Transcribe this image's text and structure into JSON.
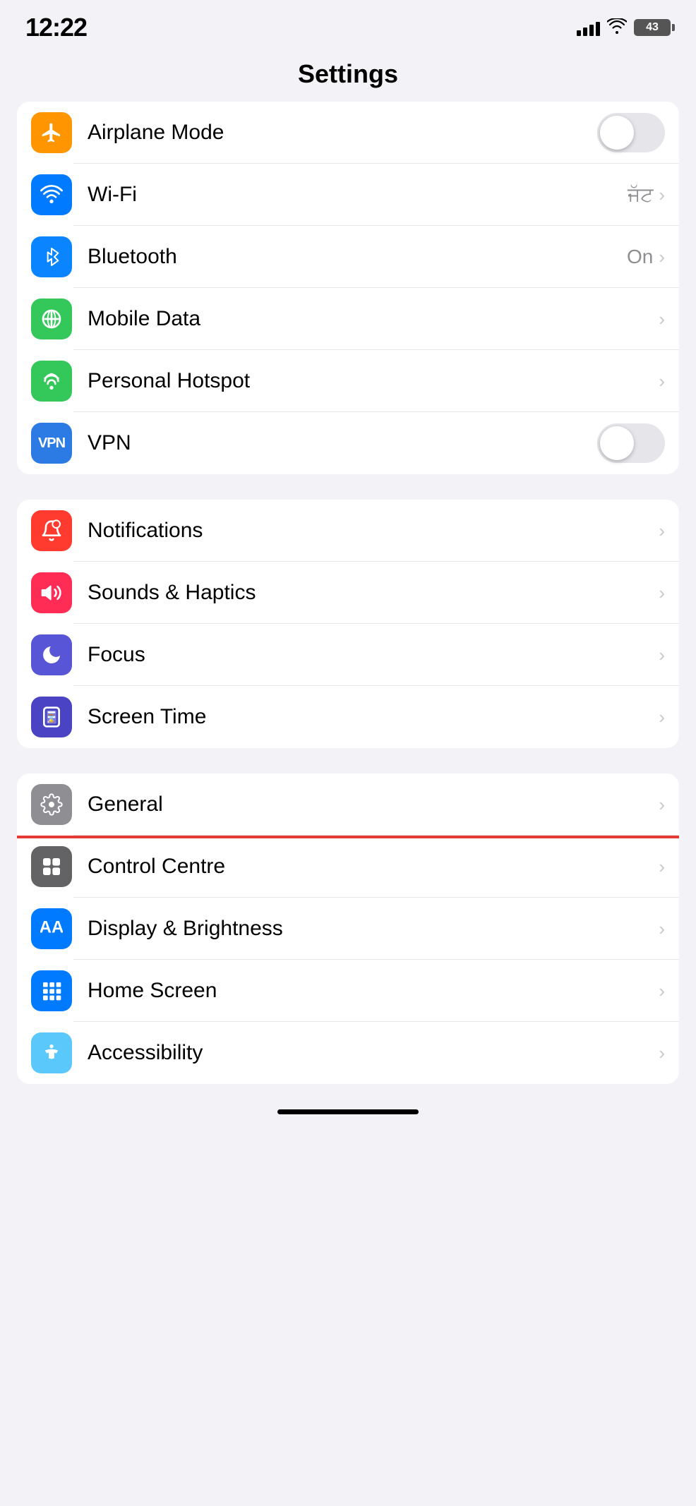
{
  "statusBar": {
    "time": "12:22",
    "battery": "43"
  },
  "pageTitle": "Settings",
  "group1": {
    "rows": [
      {
        "id": "airplane-mode",
        "label": "Airplane Mode",
        "iconBg": "bg-orange",
        "icon": "airplane",
        "control": "toggle",
        "toggleOn": false,
        "value": "",
        "chevron": false
      },
      {
        "id": "wifi",
        "label": "Wi-Fi",
        "iconBg": "bg-blue",
        "icon": "wifi",
        "control": "chevron",
        "value": "ਜੱਟ",
        "chevron": true
      },
      {
        "id": "bluetooth",
        "label": "Bluetooth",
        "iconBg": "bg-blue-dark",
        "icon": "bluetooth",
        "control": "chevron",
        "value": "On",
        "chevron": true
      },
      {
        "id": "mobile-data",
        "label": "Mobile Data",
        "iconBg": "bg-green",
        "icon": "mobile-data",
        "control": "chevron",
        "value": "",
        "chevron": true
      },
      {
        "id": "personal-hotspot",
        "label": "Personal Hotspot",
        "iconBg": "bg-green",
        "icon": "hotspot",
        "control": "chevron",
        "value": "",
        "chevron": true
      },
      {
        "id": "vpn",
        "label": "VPN",
        "iconBg": "bg-vpn-blue",
        "icon": "vpn",
        "control": "toggle",
        "toggleOn": false,
        "value": "",
        "chevron": false
      }
    ]
  },
  "group2": {
    "rows": [
      {
        "id": "notifications",
        "label": "Notifications",
        "iconBg": "bg-red",
        "icon": "notifications",
        "control": "chevron",
        "value": "",
        "chevron": true
      },
      {
        "id": "sounds-haptics",
        "label": "Sounds & Haptics",
        "iconBg": "bg-pink",
        "icon": "sounds",
        "control": "chevron",
        "value": "",
        "chevron": true
      },
      {
        "id": "focus",
        "label": "Focus",
        "iconBg": "bg-purple",
        "icon": "focus",
        "control": "chevron",
        "value": "",
        "chevron": true
      },
      {
        "id": "screen-time",
        "label": "Screen Time",
        "iconBg": "bg-indigo",
        "icon": "screen-time",
        "control": "chevron",
        "value": "",
        "chevron": true
      }
    ]
  },
  "group3": {
    "rows": [
      {
        "id": "general",
        "label": "General",
        "iconBg": "bg-gray",
        "icon": "general",
        "control": "chevron",
        "value": "",
        "chevron": true,
        "highlighted": true
      },
      {
        "id": "control-centre",
        "label": "Control Centre",
        "iconBg": "bg-gray-dark",
        "icon": "control-centre",
        "control": "chevron",
        "value": "",
        "chevron": true
      },
      {
        "id": "display-brightness",
        "label": "Display & Brightness",
        "iconBg": "bg-blue",
        "icon": "display",
        "control": "chevron",
        "value": "",
        "chevron": true
      },
      {
        "id": "home-screen",
        "label": "Home Screen",
        "iconBg": "bg-blue",
        "icon": "home-screen",
        "control": "chevron",
        "value": "",
        "chevron": true
      },
      {
        "id": "accessibility",
        "label": "Accessibility",
        "iconBg": "bg-teal",
        "icon": "accessibility",
        "control": "chevron",
        "value": "",
        "chevron": true
      }
    ]
  }
}
